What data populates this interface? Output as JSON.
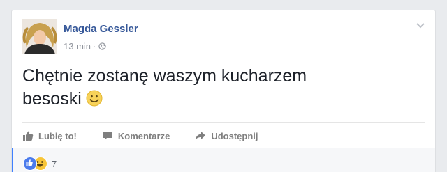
{
  "post": {
    "author": "Magda Gessler",
    "time": "13 min",
    "separator": "·",
    "text": "Chętnie zostanę waszym kucharzem besoski",
    "privacy_icon": "globe-icon",
    "emoji_icon": "smiley-icon"
  },
  "actions": {
    "like": "Lubię to!",
    "comment": "Komentarze",
    "share": "Udostępnij"
  },
  "reactions": {
    "types": [
      "like-icon",
      "haha-icon"
    ],
    "count": "7"
  },
  "colors": {
    "accent": "#365899",
    "selected_border": "#4080ff"
  }
}
